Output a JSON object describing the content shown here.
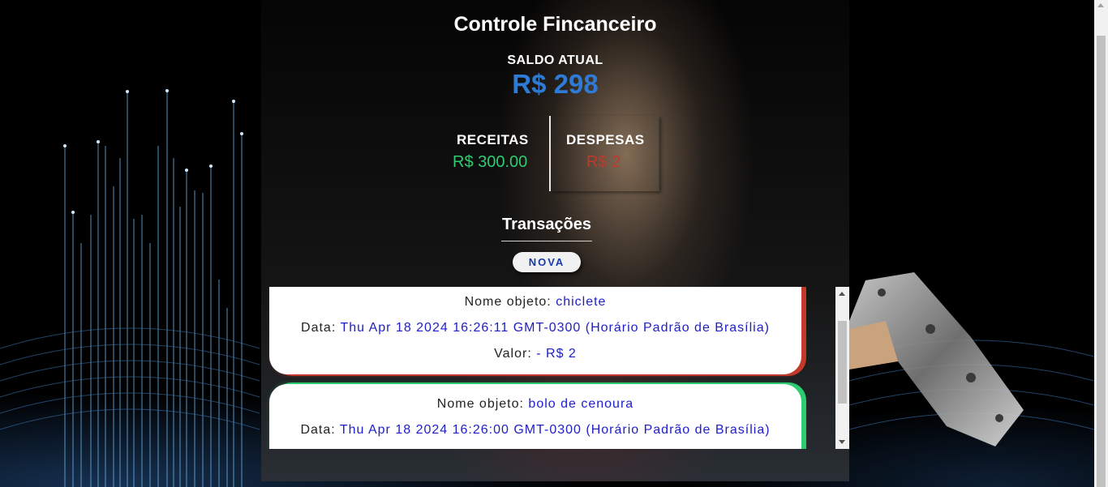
{
  "app": {
    "title": "Controle Fincanceiro"
  },
  "balance": {
    "label": "SALDO ATUAL",
    "value": "R$ 298"
  },
  "summary": {
    "income_label": "RECEITAS",
    "income_value": "R$ 300.00",
    "expense_label": "DESPESAS",
    "expense_value": "R$ 2"
  },
  "transactions": {
    "title": "Transações",
    "new_button": "NOVA",
    "items": [
      {
        "name_label": "Nome objeto:",
        "name": "chiclete",
        "date_label": "Data:",
        "date": "Thu Apr 18 2024 16:26:11 GMT-0300 (Horário Padrão de Brasília)",
        "value_label": "Valor:",
        "value": "- R$ 2",
        "type": "expense"
      },
      {
        "name_label": "Nome objeto:",
        "name": "bolo de cenoura",
        "date_label": "Data:",
        "date": "Thu Apr 18 2024 16:26:00 GMT-0300 (Horário Padrão de Brasília)",
        "type": "income"
      }
    ]
  },
  "colors": {
    "balance": "#2e7bd6",
    "income": "#2ecc71",
    "expense": "#c0392b",
    "value_text": "#1e1ec8"
  }
}
